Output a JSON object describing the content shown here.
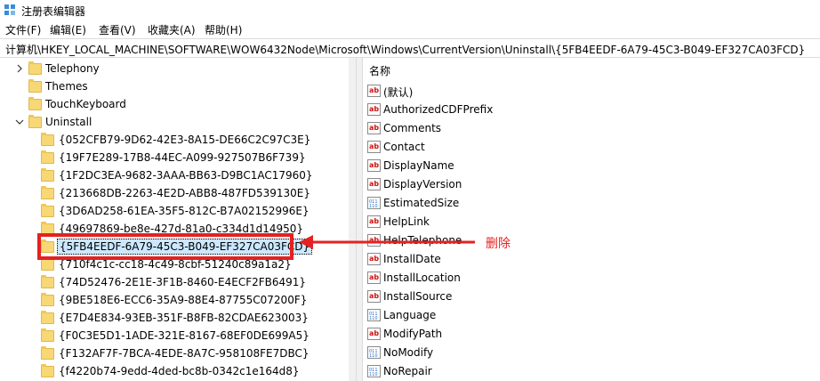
{
  "window": {
    "title": "注册表编辑器"
  },
  "menu": [
    "文件(F)",
    "编辑(E)",
    "查看(V)",
    "收藏夹(A)",
    "帮助(H)"
  ],
  "address": "计算机\\HKEY_LOCAL_MACHINE\\SOFTWARE\\WOW6432Node\\Microsoft\\Windows\\CurrentVersion\\Uninstall\\{5FB4EEDF-6A79-45C3-B049-EF327CA03FCD}",
  "tree": {
    "parents": [
      {
        "label": "Telephony",
        "state": "collapsed"
      },
      {
        "label": "Themes",
        "state": "none"
      },
      {
        "label": "TouchKeyboard",
        "state": "none"
      },
      {
        "label": "Uninstall",
        "state": "expanded"
      }
    ],
    "children": [
      "{052CFB79-9D62-42E3-8A15-DE66C2C97C3E}",
      "{19F7E289-17B8-44EC-A099-927507B6F739}",
      "{1F2DC3EA-9682-3AAA-BB63-D9BC1AC17960}",
      "{213668DB-2263-4E2D-ABB8-487FD539130E}",
      "{3D6AD258-61EA-35F5-812C-B7A02152996E}",
      "{49697869-be8e-427d-81a0-c334d1d14950}",
      "{5FB4EEDF-6A79-45C3-B049-EF327CA03FCD}",
      "{710f4c1c-cc18-4c49-8cbf-51240c89a1a2}",
      "{74D52476-2E1E-3F1B-8460-E4ECF2FB6491}",
      "{9BE518E6-ECC6-35A9-88E4-87755C07200F}",
      "{E7D4E834-93EB-351F-B8FB-82CDAE623003}",
      "{F0C3E5D1-1ADE-321E-8167-68EF0DE699A5}",
      "{F132AF7F-7BCA-4EDE-8A7C-958108FE7DBC}",
      "{f4220b74-9edd-4ded-bc8b-0342c1e164d8}"
    ],
    "selected_index": 6
  },
  "values_pane": {
    "column_header": "名称",
    "rows": [
      {
        "name": "(默认)",
        "icon": "string-value-icon"
      },
      {
        "name": "AuthorizedCDFPrefix",
        "icon": "string-value-icon"
      },
      {
        "name": "Comments",
        "icon": "string-value-icon"
      },
      {
        "name": "Contact",
        "icon": "string-value-icon"
      },
      {
        "name": "DisplayName",
        "icon": "string-value-icon"
      },
      {
        "name": "DisplayVersion",
        "icon": "string-value-icon"
      },
      {
        "name": "EstimatedSize",
        "icon": "binary-value-icon"
      },
      {
        "name": "HelpLink",
        "icon": "string-value-icon"
      },
      {
        "name": "HelpTelephone",
        "icon": "string-value-icon"
      },
      {
        "name": "InstallDate",
        "icon": "string-value-icon"
      },
      {
        "name": "InstallLocation",
        "icon": "string-value-icon"
      },
      {
        "name": "InstallSource",
        "icon": "string-value-icon"
      },
      {
        "name": "Language",
        "icon": "binary-value-icon"
      },
      {
        "name": "ModifyPath",
        "icon": "string-value-icon"
      },
      {
        "name": "NoModify",
        "icon": "binary-value-icon"
      },
      {
        "name": "NoRepair",
        "icon": "binary-value-icon"
      }
    ]
  },
  "annotation": {
    "text": "删除",
    "color": "#e32222"
  }
}
